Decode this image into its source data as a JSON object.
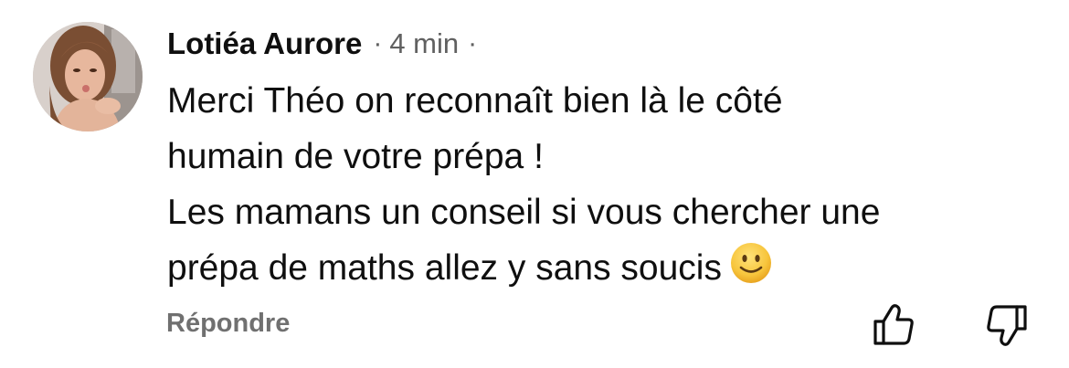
{
  "comment": {
    "author": "Lotiéa Aurore",
    "separator": "·",
    "timestamp": "4 min",
    "body_lines": [
      "Merci Théo on reconnaît bien là le côté",
      "humain de votre prépa !",
      "Les mamans un conseil si vous chercher une",
      "prépa de maths allez y sans soucis"
    ],
    "emoji": "slightly-smiling-face",
    "avatar": "profile-photo"
  },
  "actions": {
    "reply_label": "Répondre",
    "like_icon": "thumbs-up-icon",
    "dislike_icon": "thumbs-down-icon"
  },
  "colors": {
    "text": "#0f0f0f",
    "secondary": "#606060",
    "reply": "#707070",
    "emoji_face": "#f7c53c"
  }
}
